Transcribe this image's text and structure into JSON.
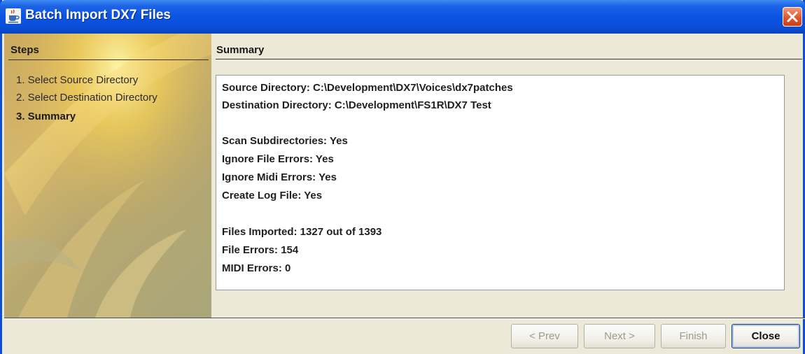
{
  "window": {
    "title": "Batch Import DX7 Files",
    "icon": "java-cup-icon",
    "close_icon": "close-icon"
  },
  "steps": {
    "header": "Steps",
    "items": [
      {
        "label": "1. Select Source Directory",
        "active": false
      },
      {
        "label": "2. Select Destination Directory",
        "active": false
      },
      {
        "label": "3. Summary",
        "active": true
      }
    ]
  },
  "summary": {
    "header": "Summary",
    "lines": [
      "Source Directory: C:\\Development\\DX7\\Voices\\dx7patches",
      "Destination Directory: C:\\Development\\FS1R\\DX7 Test",
      "",
      "Scan Subdirectories: Yes",
      "Ignore File Errors: Yes",
      "Ignore Midi Errors: Yes",
      "Create Log File: Yes",
      "",
      "Files Imported: 1327 out of 1393",
      "File Errors: 154",
      "MIDI Errors: 0"
    ]
  },
  "buttons": {
    "prev": "< Prev",
    "next": "Next >",
    "finish": "Finish",
    "close": "Close"
  },
  "colors": {
    "titlebar": "#0a54e3",
    "close_button": "#e0562d",
    "dialog_bg": "#ece9d8"
  }
}
